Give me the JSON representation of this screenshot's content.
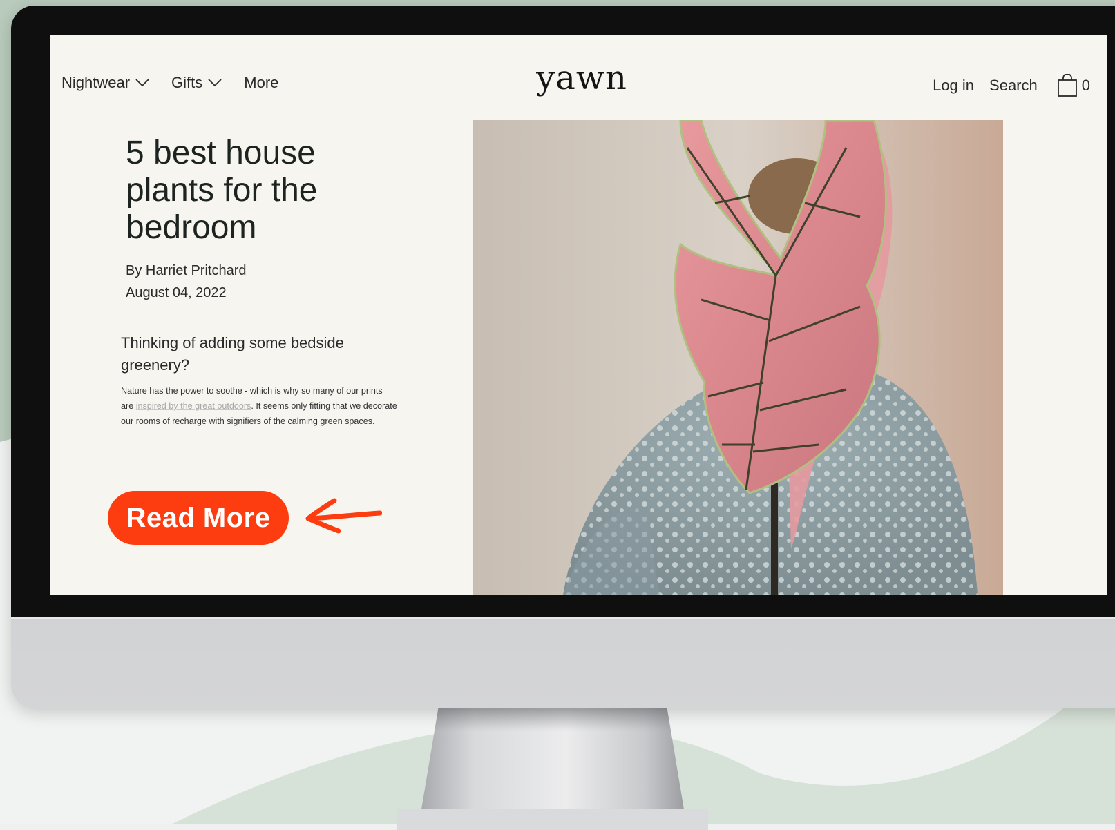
{
  "nav": {
    "items": [
      {
        "label": "Nightwear",
        "has_dropdown": true
      },
      {
        "label": "Gifts",
        "has_dropdown": true
      },
      {
        "label": "More",
        "has_dropdown": false
      }
    ],
    "logo": "yawn",
    "login_label": "Log in",
    "search_label": "Search",
    "cart_count": "0"
  },
  "article": {
    "title": "5 best house plants for the bedroom",
    "author": "By Harriet Pritchard",
    "date": "August 04, 2022",
    "subheading": "Thinking of adding some bedside greenery?",
    "body_before_link": "Nature has the power to soothe - which is why so many of our prints are ",
    "body_link": "inspired by the great outdoors",
    "body_after_link": ". It seems only fitting that we decorate our rooms of recharge with signifiers of the calming green spaces."
  },
  "cta": {
    "label": "Read More"
  },
  "colors": {
    "cta": "#fd3c10",
    "screen_bg": "#f7f5ef",
    "bezel": "#0f0f0f",
    "accent_green": "#cdd9cf"
  }
}
